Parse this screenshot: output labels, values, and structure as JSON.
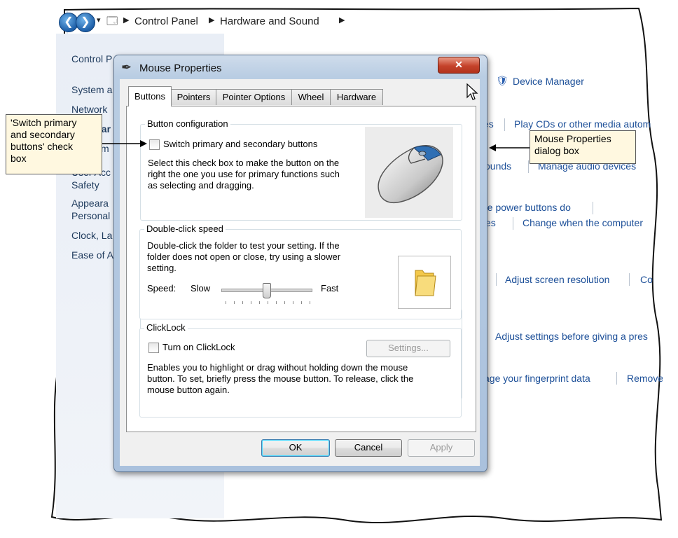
{
  "address_bar": {
    "crumbs": [
      "Control Panel",
      "Hardware and Sound"
    ]
  },
  "left_pane": {
    "items": [
      "Control P",
      "System a",
      "Network",
      "Hardwar",
      "Program",
      "User Acc",
      "Safety",
      "Appeara",
      "Personal",
      "Clock, La",
      "Ease of A"
    ]
  },
  "right_pane": {
    "device_manager": "Device Manager",
    "play_cds": "Play CDs or other media autom",
    "es_fragment": "es",
    "sounds_fragment": "ounds",
    "manage_audio": "Manage audio devices",
    "power_buttons": "he power buttons do",
    "kes_fragment": "kes",
    "change_computer": "Change when the computer",
    "adjust_resolution": "Adjust screen resolution",
    "co_fragment": "Co",
    "adjust_settings": "Adjust settings before giving a pres",
    "fingerprint": "age your fingerprint data",
    "remove_fragment": "Remove"
  },
  "dialog": {
    "title": "Mouse Properties",
    "tabs": [
      "Buttons",
      "Pointers",
      "Pointer Options",
      "Wheel",
      "Hardware"
    ],
    "button_config": {
      "label": "Button configuration",
      "checkbox": "Switch primary and secondary buttons",
      "description": [
        "Select this check box to make the button on the",
        "right the one you use for primary functions such",
        "as selecting and dragging."
      ]
    },
    "double_click": {
      "label": "Double-click speed",
      "description": [
        "Double-click the folder to test your setting. If the",
        "folder does not open or close, try using a slower",
        "setting."
      ],
      "speed_label": "Speed:",
      "slow": "Slow",
      "fast": "Fast",
      "slider_fraction": 0.5
    },
    "clicklock": {
      "label": "ClickLock",
      "checkbox": "Turn on ClickLock",
      "settings_button": "Settings...",
      "description": [
        "Enables you to highlight or drag without holding down the mouse",
        "button. To set, briefly press the mouse button. To release, click the",
        "mouse button again."
      ]
    },
    "ok": "OK",
    "cancel": "Cancel",
    "apply": "Apply"
  },
  "callouts": {
    "checkbox_callout": [
      "'Switch primary",
      "and secondary",
      "buttons' check",
      "box"
    ],
    "dialog_callout": [
      "Mouse Properties",
      "dialog box"
    ]
  }
}
